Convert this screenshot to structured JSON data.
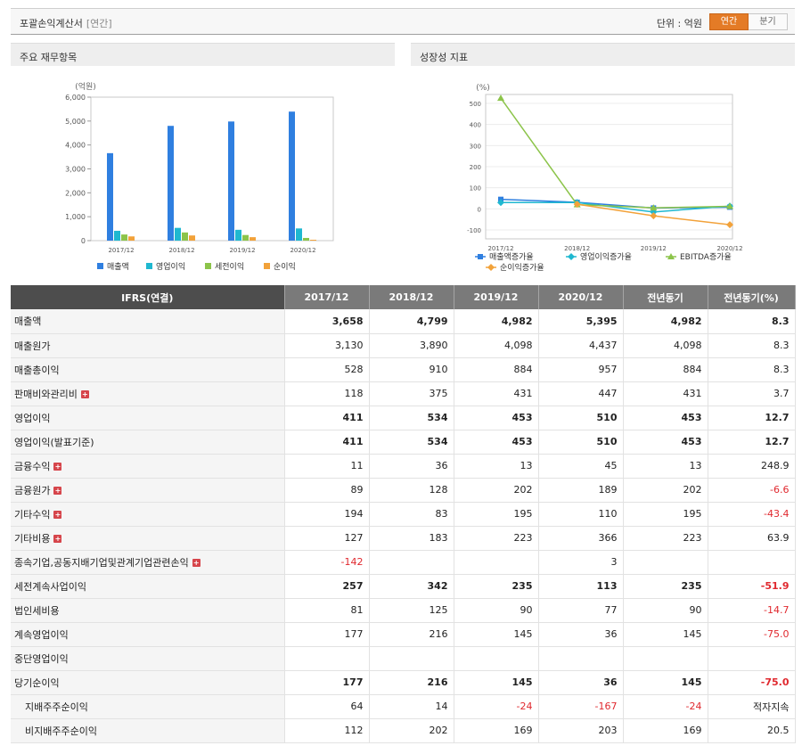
{
  "header": {
    "title": "포괄손익계산서",
    "subtitle": "[연간]",
    "unit": "단위 : 억원",
    "toggle": [
      "연간",
      "분기"
    ],
    "toggle_selected": 0
  },
  "panels": {
    "left_title": "주요 재무항목",
    "right_title": "성장성 지표"
  },
  "chart_data": [
    {
      "type": "bar",
      "ylabel": "(억원)",
      "ylim": [
        0,
        6000
      ],
      "yticks": [
        "0",
        "1,000",
        "2,000",
        "3,000",
        "4,000",
        "5,000",
        "6,000"
      ],
      "categories": [
        "2017/12",
        "2018/12",
        "2019/12",
        "2020/12"
      ],
      "series": [
        {
          "name": "매출액",
          "color": "#2f7fe0",
          "values": [
            3658,
            4799,
            4982,
            5395
          ]
        },
        {
          "name": "영업이익",
          "color": "#1fb8d0",
          "values": [
            411,
            534,
            453,
            510
          ]
        },
        {
          "name": "세전이익",
          "color": "#8cc44a",
          "values": [
            257,
            342,
            235,
            113
          ]
        },
        {
          "name": "순이익",
          "color": "#f2a23a",
          "values": [
            177,
            216,
            145,
            36
          ]
        }
      ],
      "legend": "bottom",
      "grid": false
    },
    {
      "type": "line",
      "ylabel": "(%)",
      "ylim": [
        -100,
        500
      ],
      "yticks": [
        "-100",
        "0",
        "100",
        "200",
        "300",
        "400",
        "500"
      ],
      "categories": [
        "2017/12",
        "2018/12",
        "2019/12",
        "2020/12"
      ],
      "series": [
        {
          "name": "매출액증가율",
          "color": "#2f7fe0",
          "marker": "square",
          "values": [
            45,
            31,
            4,
            8
          ]
        },
        {
          "name": "영업이익증가율",
          "color": "#1fb8d0",
          "marker": "diamond",
          "values": [
            30,
            30,
            -15,
            13
          ]
        },
        {
          "name": "EBITDA증가율",
          "color": "#8cc44a",
          "marker": "triangle",
          "values": [
            525,
            20,
            5,
            12
          ]
        },
        {
          "name": "순이익증가율",
          "color": "#f2a23a",
          "marker": "diamond",
          "values": [
            null,
            22,
            -33,
            -75
          ]
        }
      ],
      "legend": "bottom",
      "grid": true
    }
  ],
  "table": {
    "headers": [
      "IFRS(연결)",
      "2017/12",
      "2018/12",
      "2019/12",
      "2020/12",
      "전년동기",
      "전년동기(%)"
    ],
    "rows": [
      {
        "label": "매출액",
        "bold": true,
        "sep": false,
        "plus": false,
        "indent": false,
        "cells": [
          "3,658",
          "4,799",
          "4,982",
          "5,395",
          "4,982",
          "8.3"
        ]
      },
      {
        "label": "매출원가",
        "bold": false,
        "sep": false,
        "plus": false,
        "indent": false,
        "cells": [
          "3,130",
          "3,890",
          "4,098",
          "4,437",
          "4,098",
          "8.3"
        ]
      },
      {
        "label": "매출총이익",
        "bold": false,
        "sep": false,
        "plus": false,
        "indent": false,
        "cells": [
          "528",
          "910",
          "884",
          "957",
          "884",
          "8.3"
        ]
      },
      {
        "label": "판매비와관리비",
        "bold": false,
        "sep": false,
        "plus": true,
        "indent": false,
        "cells": [
          "118",
          "375",
          "431",
          "447",
          "431",
          "3.7"
        ]
      },
      {
        "label": "영업이익",
        "bold": true,
        "sep": true,
        "plus": false,
        "indent": false,
        "cells": [
          "411",
          "534",
          "453",
          "510",
          "453",
          "12.7"
        ]
      },
      {
        "label": "영업이익(발표기준)",
        "bold": true,
        "sep": false,
        "plus": false,
        "indent": false,
        "cells": [
          "411",
          "534",
          "453",
          "510",
          "453",
          "12.7"
        ]
      },
      {
        "label": "금융수익",
        "bold": false,
        "sep": true,
        "plus": true,
        "indent": false,
        "cells": [
          "11",
          "36",
          "13",
          "45",
          "13",
          "248.9"
        ]
      },
      {
        "label": "금융원가",
        "bold": false,
        "sep": false,
        "plus": true,
        "indent": false,
        "cells": [
          "89",
          "128",
          "202",
          "189",
          "202",
          "-6.6"
        ]
      },
      {
        "label": "기타수익",
        "bold": false,
        "sep": false,
        "plus": true,
        "indent": false,
        "cells": [
          "194",
          "83",
          "195",
          "110",
          "195",
          "-43.4"
        ]
      },
      {
        "label": "기타비용",
        "bold": false,
        "sep": false,
        "plus": true,
        "indent": false,
        "cells": [
          "127",
          "183",
          "223",
          "366",
          "223",
          "63.9"
        ]
      },
      {
        "label": "종속기업,공동지배기업및관계기업관련손익",
        "bold": false,
        "sep": false,
        "plus": true,
        "indent": false,
        "cells": [
          "-142",
          "",
          "",
          "3",
          "",
          ""
        ]
      },
      {
        "label": "세전계속사업이익",
        "bold": true,
        "sep": true,
        "plus": false,
        "indent": false,
        "cells": [
          "257",
          "342",
          "235",
          "113",
          "235",
          "-51.9"
        ]
      },
      {
        "label": "법인세비용",
        "bold": false,
        "sep": false,
        "plus": false,
        "indent": false,
        "cells": [
          "81",
          "125",
          "90",
          "77",
          "90",
          "-14.7"
        ]
      },
      {
        "label": "계속영업이익",
        "bold": false,
        "sep": false,
        "plus": false,
        "indent": false,
        "cells": [
          "177",
          "216",
          "145",
          "36",
          "145",
          "-75.0"
        ]
      },
      {
        "label": "중단영업이익",
        "bold": false,
        "sep": false,
        "plus": false,
        "indent": false,
        "cells": [
          "",
          "",
          "",
          "",
          "",
          ""
        ]
      },
      {
        "label": "당기순이익",
        "bold": true,
        "sep": true,
        "plus": false,
        "indent": false,
        "cells": [
          "177",
          "216",
          "145",
          "36",
          "145",
          "-75.0"
        ]
      },
      {
        "label": "지배주주순이익",
        "bold": false,
        "sep": false,
        "plus": false,
        "indent": true,
        "cells": [
          "64",
          "14",
          "-24",
          "-167",
          "-24",
          "적자지속"
        ]
      },
      {
        "label": "비지배주주순이익",
        "bold": false,
        "sep": false,
        "plus": false,
        "indent": true,
        "cells": [
          "112",
          "202",
          "169",
          "203",
          "169",
          "20.5"
        ]
      }
    ]
  }
}
